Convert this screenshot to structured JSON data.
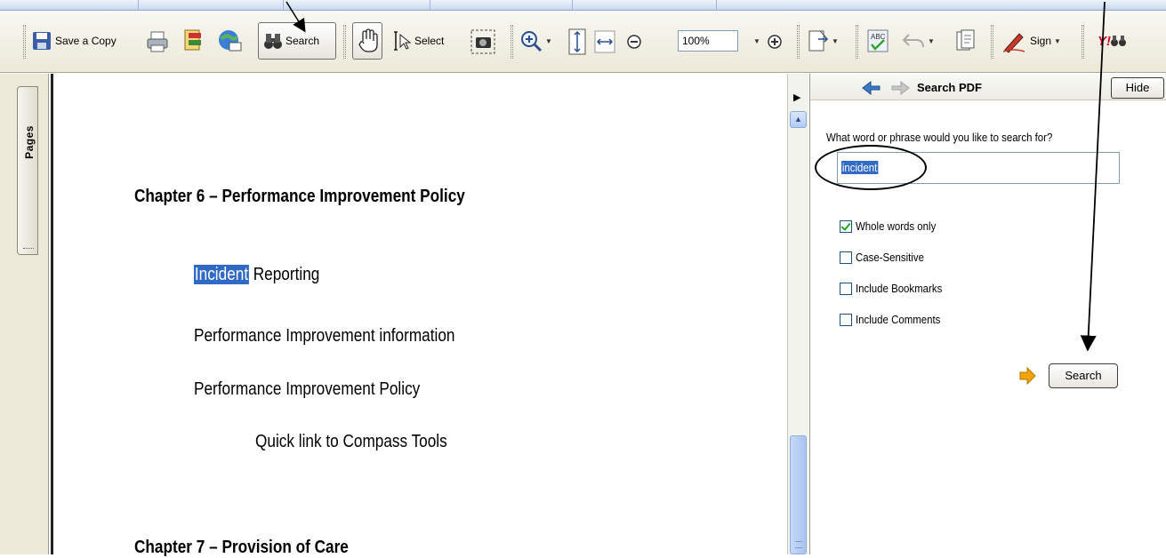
{
  "toolbar": {
    "save_copy_label": "Save a Copy",
    "search_label": "Search",
    "select_label": "Select",
    "zoom_value": "100%",
    "sign_label": "Sign",
    "yahoo_label": "Y!",
    "icons": [
      "save-icon",
      "print-icon",
      "organize-icon",
      "email-icon",
      "binoculars-icon",
      "hand-icon",
      "select-cursor-icon",
      "snapshot-icon",
      "zoom-in-icon",
      "fit-page-icon",
      "fit-width-icon",
      "zoom-out-icon",
      "zoom-plus-icon",
      "page-menu-icon",
      "spellcheck-icon",
      "undo-icon",
      "document-icon",
      "sign-pen-icon",
      "yahoo-search-icon"
    ]
  },
  "left_panel": {
    "tab_label": "Pages"
  },
  "document": {
    "chapter6": "Chapter 6 – Performance Improvement Policy",
    "incident_highlight": "Incident",
    "incident_rest": " Reporting",
    "pi_information": "Performance Improvement information",
    "pi_policy": "Performance Improvement Policy",
    "quick_link": "Quick link to Compass Tools",
    "chapter7": "Chapter 7 – Provision of Care"
  },
  "search_pane": {
    "title": "Search PDF",
    "hide_label": "Hide",
    "question": "What word or phrase would you like to search for?",
    "query": "incident",
    "options": [
      {
        "label": "Whole words only",
        "checked": true
      },
      {
        "label": "Case-Sensitive",
        "checked": false
      },
      {
        "label": "Include Bookmarks",
        "checked": false
      },
      {
        "label": "Include Comments",
        "checked": false
      }
    ],
    "search_button": "Search"
  },
  "colors": {
    "highlight": "#316ac5",
    "toolbar": "#ece9d8",
    "arrow_orange": "#f0a30a"
  }
}
